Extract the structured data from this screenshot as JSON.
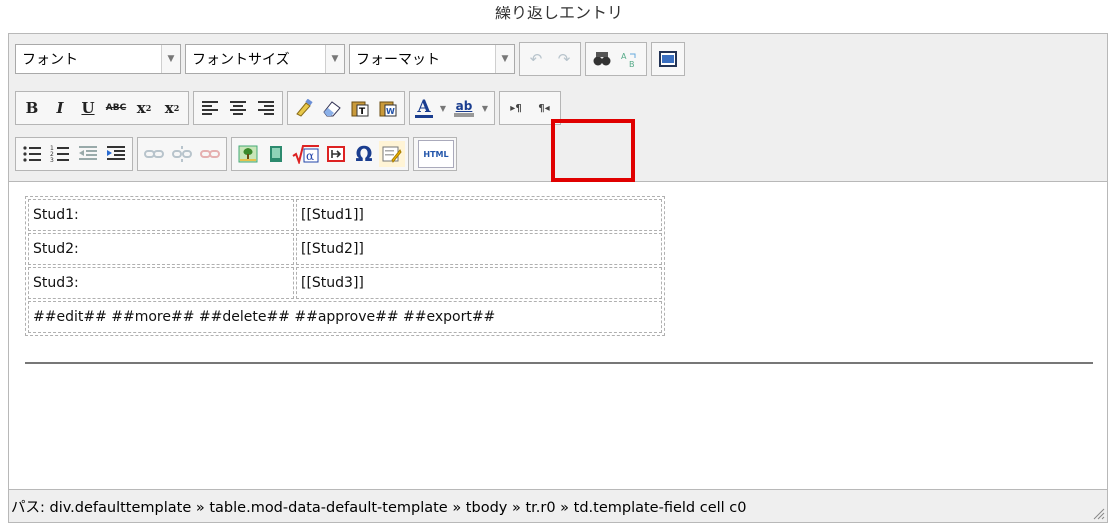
{
  "page_title": "繰り返しエントリ",
  "toolbar": {
    "font_select": "フォント",
    "fontsize_select": "フォントサイズ",
    "format_select": "フォーマット",
    "bold": "B",
    "italic": "I",
    "underline": "U",
    "strike": "ABC",
    "subscript": "x",
    "superscript": "x",
    "text_color": "A",
    "bg_color": "ab",
    "omega": "Ω",
    "html": "HTML",
    "ltr": "▸¶",
    "rtl": "¶◂"
  },
  "icons": [
    "undo-icon",
    "redo-icon",
    "find-icon",
    "replace-icon",
    "fullscreen-icon",
    "align-left-icon",
    "align-center-icon",
    "align-right-icon",
    "cleanup-icon",
    "eraser-icon",
    "paste-text-icon",
    "paste-word-icon",
    "unordered-list-icon",
    "ordered-list-icon",
    "outdent-icon",
    "indent-icon",
    "link-icon",
    "unlink-icon",
    "anchor-icon",
    "image-icon",
    "media-icon",
    "math-icon",
    "nonbreaking-icon",
    "special-char-icon",
    "insert-field-icon",
    "html-icon"
  ],
  "table": {
    "rows": [
      {
        "label": "Stud1:",
        "value": "[[Stud1]]"
      },
      {
        "label": "Stud2:",
        "value": "[[Stud2]]"
      },
      {
        "label": "Stud3:",
        "value": "[[Stud3]]"
      }
    ],
    "actions": "##edit## ##more## ##delete## ##approve## ##export##"
  },
  "status": {
    "path": "パス: div.defaulttemplate » table.mod-data-default-template » tbody » tr.r0 » td.template-field cell c0"
  },
  "colors": {
    "highlight": "#e00000",
    "toolbar_bg": "#efefef"
  }
}
